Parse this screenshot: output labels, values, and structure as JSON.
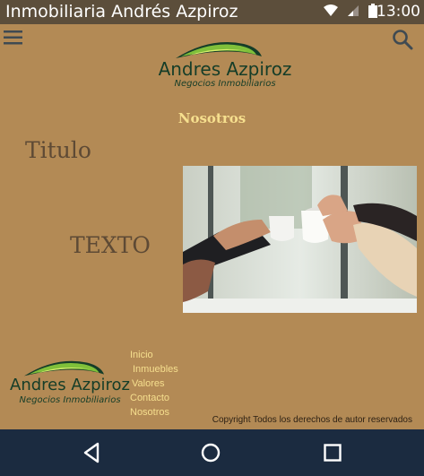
{
  "statusbar": {
    "title": "Inmobiliaria Andrés Azpiroz",
    "time": "13:00",
    "icons": [
      "wifi-icon",
      "signal-icon",
      "battery-icon"
    ]
  },
  "header": {
    "menu_icon": "hamburger-menu-icon",
    "search_icon": "search-icon"
  },
  "logo": {
    "name": "Andres Azpiroz",
    "tagline": "Negocios Inmobiliarios"
  },
  "main": {
    "section_title": "Nosotros",
    "heading": "Titulo",
    "body": "TEXTO"
  },
  "footer": {
    "links": [
      "Inicio",
      "Inmuebles",
      "Valores",
      "Contacto",
      "Nosotros"
    ],
    "copyright": "Copyright Todos los derechos de autor reservados"
  },
  "navbar": {
    "buttons": [
      "back-icon",
      "home-icon",
      "recents-icon"
    ]
  },
  "colors": {
    "background": "#b38a55",
    "accent": "#f6df8e",
    "statusbar": "#5c4e3b",
    "navbar": "#1b2b40",
    "logo_green": "#153d28"
  }
}
